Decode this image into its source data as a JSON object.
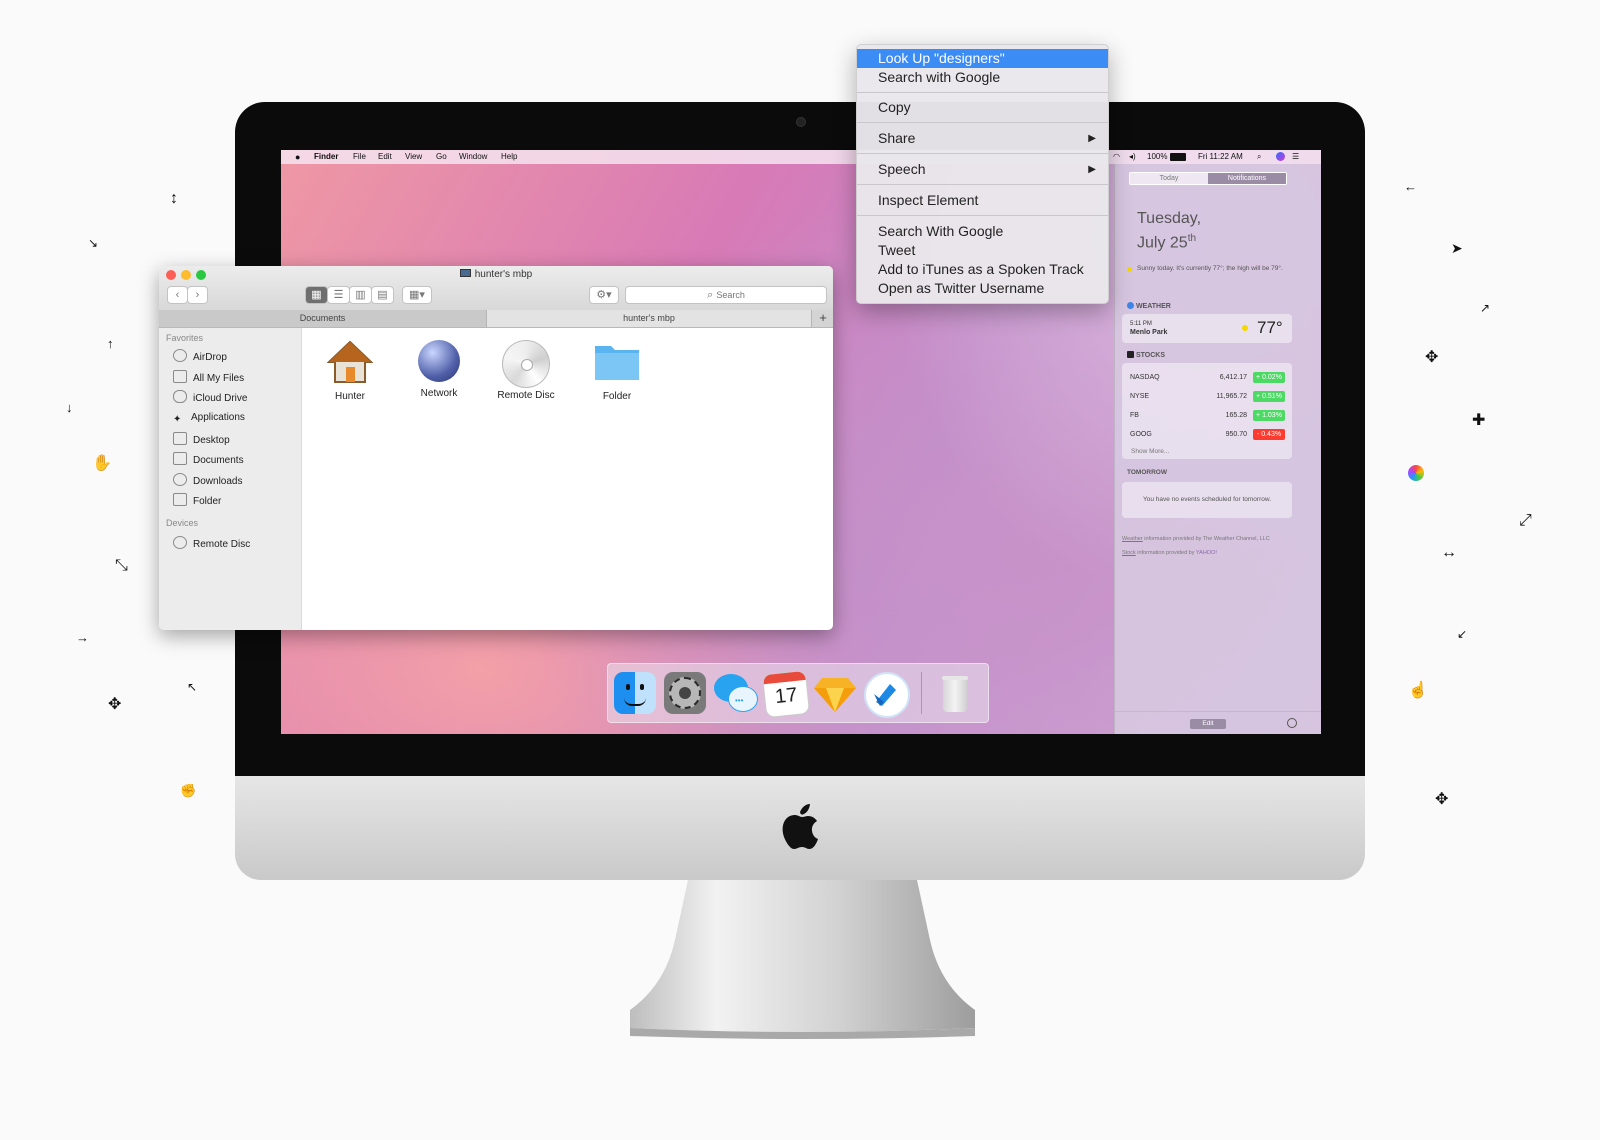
{
  "menubar": {
    "apple": "",
    "items": [
      "Finder",
      "File",
      "Edit",
      "View",
      "Go",
      "Window",
      "Help"
    ],
    "battery": "100%",
    "clock": "Fri 11:22 AM"
  },
  "finder": {
    "title": "hunter's mbp",
    "search_placeholder": "Search",
    "tabs": [
      "Documents",
      "hunter's mbp"
    ],
    "add_tab": "+",
    "sidebar": {
      "favorites_header": "Favorites",
      "favorites": [
        "AirDrop",
        "All My Files",
        "iCloud Drive",
        "Applications",
        "Desktop",
        "Documents",
        "Downloads",
        "Folder"
      ],
      "devices_header": "Devices",
      "devices": [
        "Remote Disc"
      ]
    },
    "items": [
      "Hunter",
      "Network",
      "Remote Disc",
      "Folder"
    ]
  },
  "context_menu": {
    "items": [
      "Look Up \"designers\"",
      "Search with Google",
      "Copy",
      "Share",
      "Speech",
      "Inspect Element",
      "Search With Google",
      "Tweet",
      "Add to iTunes as a Spoken Track",
      "Open as Twitter Username"
    ],
    "submenu_arrow": "▶"
  },
  "notification_center": {
    "tabs": [
      "Today",
      "Notifications"
    ],
    "date_line1": "Tuesday,",
    "date_line2": "July 25",
    "date_suffix": "th",
    "summary": "Sunny today. It's currently 77°; the high will be 79°.",
    "weather_header": "WEATHER",
    "weather_time": "5:11 PM",
    "weather_location": "Menlo Park",
    "weather_temp": "77°",
    "stocks_header": "STOCKS",
    "stocks": [
      {
        "symbol": "NASDAQ",
        "price": "6,412.17",
        "change": "+ 0.02%",
        "color": "#4cd964"
      },
      {
        "symbol": "NYSE",
        "price": "11,965.72",
        "change": "+ 0.51%",
        "color": "#4cd964"
      },
      {
        "symbol": "FB",
        "price": "165.28",
        "change": "+ 1.03%",
        "color": "#4cd964"
      },
      {
        "symbol": "GOOG",
        "price": "950.70",
        "change": "- 0.43%",
        "color": "#ff3b30"
      }
    ],
    "show_more": "Show More...",
    "tomorrow_header": "TOMORROW",
    "tomorrow_text": "You have no events scheduled for tomorrow.",
    "credit1_link": "Weather",
    "credit1": " information provided by The Weather Channel, LLC",
    "credit2_link": "Stock",
    "credit2": " information provided by",
    "credit2_brand": "YAHOO!",
    "edit": "Edit"
  },
  "dock": {
    "calendar_day": "17",
    "apps": [
      "finder-icon",
      "system-preferences-icon",
      "messages-icon",
      "calendar-icon",
      "sketch-icon",
      "tweetbot-icon",
      "trash-icon"
    ]
  }
}
